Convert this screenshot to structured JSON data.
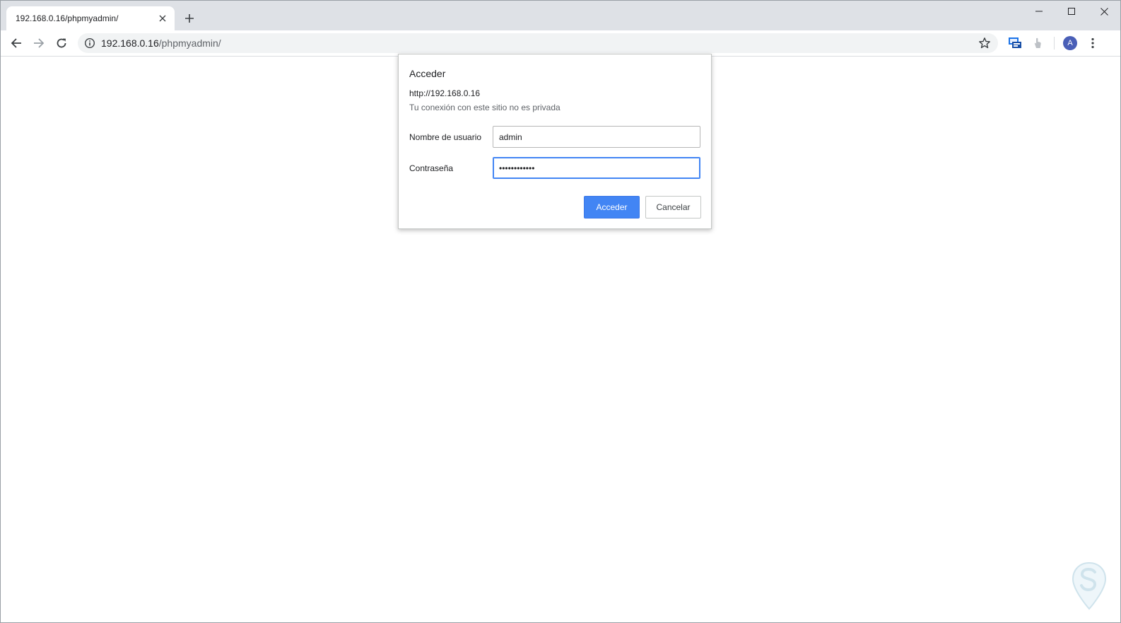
{
  "browser": {
    "tab": {
      "title": "192.168.0.16/phpmyadmin/"
    },
    "omnibox": {
      "host": "192.168.0.16",
      "path": "/phpmyadmin/"
    },
    "profile_initial": "A"
  },
  "dialog": {
    "title": "Acceder",
    "origin": "http://192.168.0.16",
    "warning": "Tu conexión con este sitio no es privada",
    "username": {
      "label": "Nombre de usuario",
      "value": "admin"
    },
    "password": {
      "label": "Contraseña",
      "value": "••••••••••••"
    },
    "submit_label": "Acceder",
    "cancel_label": "Cancelar"
  },
  "colors": {
    "accent": "#4285f4",
    "tabstrip": "#dee1e6",
    "omnibox": "#f1f3f4",
    "avatar": "#4a5fb7"
  },
  "icons": {
    "back": "arrow-left-icon",
    "forward": "arrow-right-icon",
    "reload": "reload-icon",
    "info": "info-icon",
    "bookmark": "star-icon",
    "extension_1": "monitor-chat-icon",
    "extension_2": "touch-hand-icon",
    "menu": "kebab-menu-icon",
    "close_tab": "close-icon",
    "new_tab": "plus-icon"
  }
}
